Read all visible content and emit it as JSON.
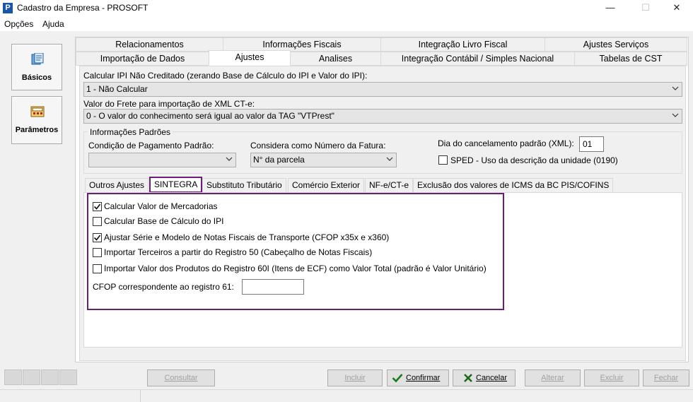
{
  "window": {
    "title": "Cadastro da Empresa - PROSOFT",
    "app_icon_letter": "P",
    "minimize": "—",
    "maximize": "☐",
    "close": "✕"
  },
  "menu": {
    "items": [
      "Opções",
      "Ajuda"
    ]
  },
  "sidebar": {
    "buttons": [
      {
        "label": "Básicos"
      },
      {
        "label": "Parâmetros"
      }
    ]
  },
  "tabs_row1": [
    "Relacionamentos",
    "Informações Fiscais",
    "Integração Livro Fiscal",
    "Ajustes Serviços"
  ],
  "tabs_row2": [
    "Importação de Dados",
    "Ajustes",
    "Analises",
    "Integração Contábil / Simples Nacional",
    "Tabelas de CST"
  ],
  "form": {
    "ipi_label": "Calcular IPI Não Creditado (zerando Base de Cálculo do IPI e Valor do IPI):",
    "ipi_value": "1 - Não Calcular",
    "frete_label": "Valor do Frete para importação de XML CT-e:",
    "frete_value": "0 - O valor do conhecimento será igual ao valor da TAG \"VTPrest\"",
    "info_group_title": "Informações Padrões",
    "cond_pag_label": "Condição de Pagamento Padrão:",
    "cond_pag_value": "",
    "num_fatura_label": "Considera como Número da Fatura:",
    "num_fatura_value": "N° da parcela",
    "dia_cancel_label": "Dia do cancelamento padrão (XML):",
    "dia_cancel_value": "01",
    "sped_label": "SPED - Uso da descrição da unidade (0190)",
    "sped_checked": false
  },
  "inner_tabs": [
    "Outros Ajustes",
    "SINTEGRA",
    "Substituto Tributário",
    "Comércio Exterior",
    "NF-e/CT-e",
    "Exclusão dos valores de ICMS da BC PIS/COFINS"
  ],
  "sintegra": {
    "options": [
      {
        "label": "Calcular Valor de  Mercadorias",
        "checked": true
      },
      {
        "label": "Calcular Base de Cálculo do  IPI",
        "checked": false
      },
      {
        "label": "Ajustar Série e Modelo de Notas Fiscais de Transporte (CFOP x35x e x360)",
        "checked": true
      },
      {
        "label": "Importar Terceiros a partir do Registro 50 (Cabeçalho de Notas Fiscais)",
        "checked": false
      },
      {
        "label": "Importar Valor dos Produtos do Registro 60I (Itens de ECF) como Valor Total (padrão é Valor Unitário)",
        "checked": false
      }
    ],
    "cfop_label": "CFOP correspondente ao registro 61:",
    "cfop_value": ""
  },
  "bottom": {
    "consultar": "Consultar",
    "incluir": "Incluir",
    "confirmar": "Confirmar",
    "cancelar": "Cancelar",
    "alterar": "Alterar",
    "excluir": "Excluir",
    "fechar": "Fechar"
  },
  "colors": {
    "highlight": "#6b1e76",
    "accent": "#1a56a8"
  }
}
